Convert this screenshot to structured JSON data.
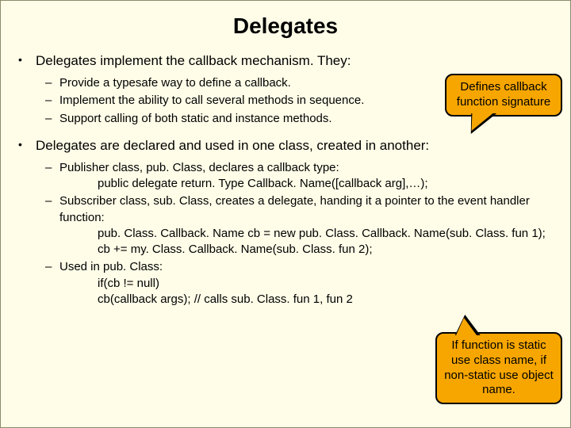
{
  "title": "Delegates",
  "bullet1": {
    "text": "Delegates implement the callback mechanism.  They:",
    "subs": [
      "Provide a typesafe way to define a callback.",
      "Implement the ability to call several methods in sequence.",
      "Support calling of both static and instance methods."
    ]
  },
  "bullet2": {
    "text": "Delegates are declared and used in one class, created in another:",
    "subs": [
      {
        "lead": "Publisher class, pub. Class, declares a callback type:",
        "lines": [
          "public delegate return. Type Callback. Name([callback arg],…);"
        ]
      },
      {
        "lead": "Subscriber class, sub. Class, creates a delegate, handing it a pointer to the event handler function:",
        "lines": [
          "pub. Class. Callback. Name cb = new  pub. Class. Callback. Name(sub. Class. fun 1);",
          "cb += my. Class. Callback. Name(sub. Class. fun 2);"
        ]
      },
      {
        "lead": "Used in pub. Class:",
        "lines": [
          "if(cb != null)",
          "   cb(callback args);  // calls sub. Class. fun 1, fun 2"
        ]
      }
    ]
  },
  "callout1": "Defines callback function signature",
  "callout2": "If function is static use class name, if non-static use object name."
}
